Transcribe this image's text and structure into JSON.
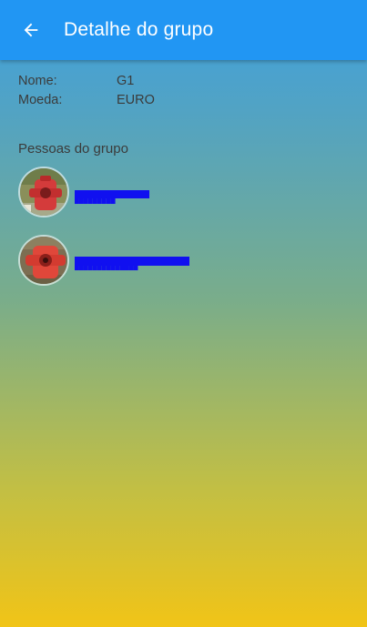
{
  "appbar": {
    "title": "Detalhe do grupo",
    "back_icon": "arrow-left-icon"
  },
  "group": {
    "name_label": "Nome:",
    "name_value": "G1",
    "currency_label": "Moeda:",
    "currency_value": "EURO"
  },
  "members_section": {
    "title": "Pessoas do grupo",
    "members": [
      {
        "avatar": "red-fire-hydrant-photo",
        "name": "█████████"
      },
      {
        "avatar": "red-fire-hydrant-photo",
        "name": "██████████████"
      }
    ]
  },
  "colors": {
    "appbar": "#2196f3",
    "gradient_top": "#3fa1e0",
    "gradient_bottom": "#f1c417",
    "redaction": "#1010f0"
  }
}
